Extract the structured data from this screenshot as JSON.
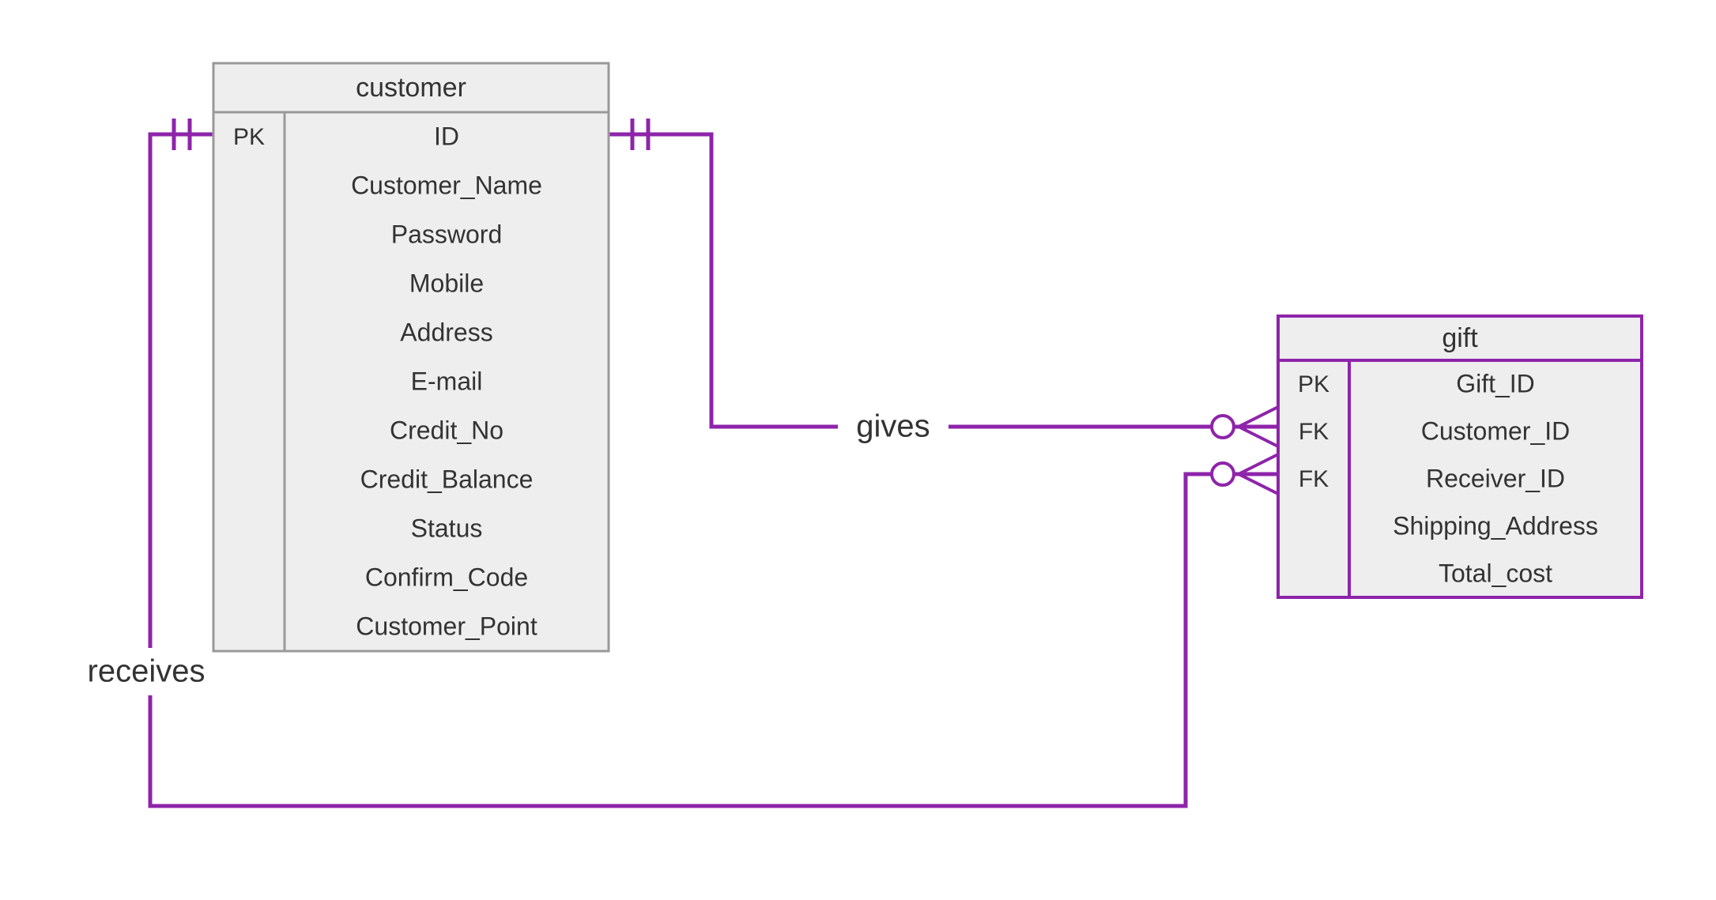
{
  "entities": {
    "customer": {
      "title": "customer",
      "keys": [
        "PK",
        "",
        "",
        "",
        "",
        "",
        "",
        "",
        "",
        "",
        ""
      ],
      "attributes": [
        "ID",
        "Customer_Name",
        "Password",
        "Mobile",
        "Address",
        "E-mail",
        "Credit_No",
        "Credit_Balance",
        "Status",
        "Confirm_Code",
        "Customer_Point"
      ]
    },
    "gift": {
      "title": "gift",
      "keys": [
        "PK",
        "FK",
        "FK",
        "",
        ""
      ],
      "attributes": [
        "Gift_ID",
        "Customer_ID",
        "Receiver_ID",
        "Shipping_Address",
        "Total_cost"
      ]
    }
  },
  "relationships": {
    "gives": {
      "label": "gives"
    },
    "receives": {
      "label": "receives"
    }
  },
  "chart_data": {
    "type": "er-diagram",
    "entities": [
      {
        "name": "customer",
        "attributes": [
          {
            "name": "ID",
            "key": "PK"
          },
          {
            "name": "Customer_Name",
            "key": null
          },
          {
            "name": "Password",
            "key": null
          },
          {
            "name": "Mobile",
            "key": null
          },
          {
            "name": "Address",
            "key": null
          },
          {
            "name": "E-mail",
            "key": null
          },
          {
            "name": "Credit_No",
            "key": null
          },
          {
            "name": "Credit_Balance",
            "key": null
          },
          {
            "name": "Status",
            "key": null
          },
          {
            "name": "Confirm_Code",
            "key": null
          },
          {
            "name": "Customer_Point",
            "key": null
          }
        ]
      },
      {
        "name": "gift",
        "attributes": [
          {
            "name": "Gift_ID",
            "key": "PK"
          },
          {
            "name": "Customer_ID",
            "key": "FK"
          },
          {
            "name": "Receiver_ID",
            "key": "FK"
          },
          {
            "name": "Shipping_Address",
            "key": null
          },
          {
            "name": "Total_cost",
            "key": null
          }
        ]
      }
    ],
    "relationships": [
      {
        "name": "gives",
        "from": "customer",
        "to": "gift",
        "from_cardinality": "one-and-only-one",
        "to_cardinality": "zero-or-many"
      },
      {
        "name": "receives",
        "from": "customer",
        "to": "gift",
        "from_cardinality": "one-and-only-one",
        "to_cardinality": "zero-or-many"
      }
    ]
  }
}
